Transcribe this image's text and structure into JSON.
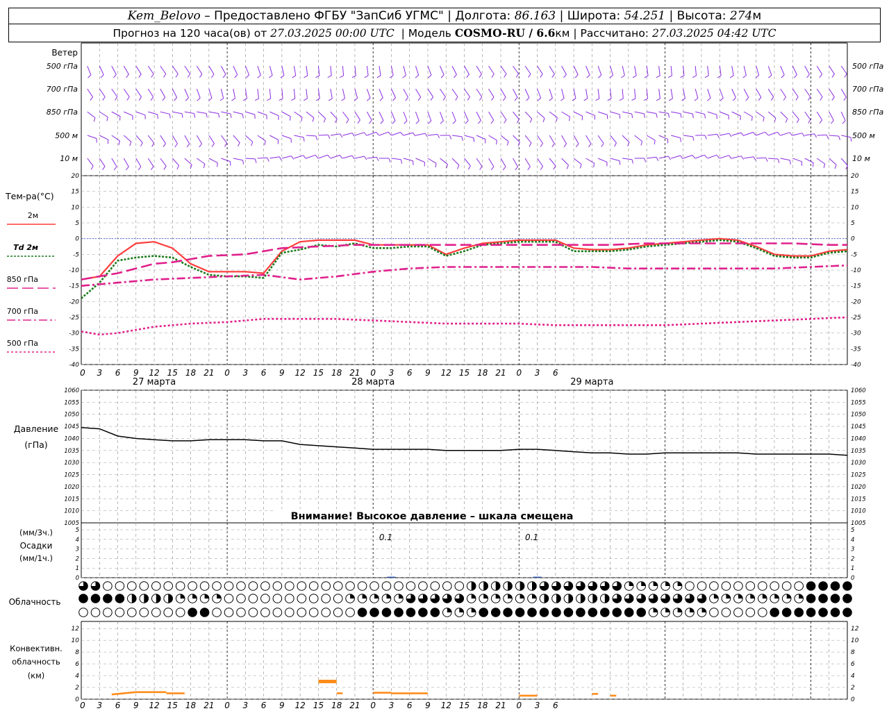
{
  "header": {
    "station": "Kem_Belovo",
    "provided": "– Предоставлено ФГБУ \"ЗапСиб УГМС\"",
    "lon_label": "Долгота:",
    "lon": "86.163",
    "lat_label": "Широта:",
    "lat": "54.251",
    "alt_label": "Высота:",
    "alt": "274",
    "alt_unit": "м",
    "forecast_label": "Прогноз на 120 часа(ов) от",
    "forecast_time": "27.03.2025 00:00 UTC",
    "model_label": "Модель",
    "model": "COSMO-RU / 6.6",
    "model_unit": "км",
    "calc_label": "Рассчитано:",
    "calc_time": "27.03.2025 04:42 UTC"
  },
  "wind_panel": {
    "title": "Ветер",
    "levels": [
      "500 гПа",
      "700 гПа",
      "850 гПа",
      "500 м",
      "10  м"
    ],
    "levels_right": [
      "500 гПа",
      "700 гПа",
      "850 гПа",
      "500 м",
      "10  м"
    ],
    "barb_color": "#8a2be2"
  },
  "axis": {
    "hour_labels": [
      "0",
      "3",
      "6",
      "9",
      "12",
      "15",
      "18",
      "21",
      "0",
      "3",
      "6",
      "9",
      "12",
      "15",
      "18",
      "21",
      "0",
      "3",
      "6",
      "9",
      "12",
      "15",
      "18",
      "21",
      "0",
      "3",
      "6"
    ],
    "dates": [
      "27 марта",
      "28 марта",
      "29 марта"
    ]
  },
  "temp_panel": {
    "title": "Тем-ра(°C)",
    "legend": [
      {
        "label": "2м",
        "color": "#ff3c3c",
        "dash": ""
      },
      {
        "label": "Td  2м",
        "color": "#1a7a1a",
        "dash": "3,2"
      },
      {
        "label": "850 гПа",
        "color": "#e0208c",
        "dash": "16,6"
      },
      {
        "label": "700 гПа",
        "color": "#e0208c",
        "dash": "12,4,3,4"
      },
      {
        "label": "500 гПа",
        "color": "#e0208c",
        "dash": "3,3"
      }
    ],
    "y_ticks": [
      "20",
      "15",
      "10",
      "5",
      "0",
      "-5",
      "-10",
      "-15",
      "-20",
      "-25",
      "-30",
      "-35",
      "-40"
    ]
  },
  "pressure_panel": {
    "title1": "Давление",
    "title2": "(гПа)",
    "y_ticks": [
      "1060",
      "1055",
      "1050",
      "1045",
      "1040",
      "1035",
      "1030",
      "1025",
      "1020",
      "1015",
      "1010",
      "1005"
    ],
    "warning": "Внимание! Высокое давление – шкала смещена"
  },
  "precip_panel": {
    "title1": "(мм/3ч.)",
    "title2": "Осадки",
    "title3": "(мм/1ч.)",
    "y_ticks": [
      "5",
      "4",
      "3",
      "2",
      "1",
      "0"
    ],
    "annotations": [
      {
        "hour": 51,
        "text": "0.1"
      },
      {
        "hour": 75,
        "text": "0.1"
      }
    ]
  },
  "cloud_panel": {
    "title": "Облачность"
  },
  "conv_panel": {
    "title1": "Конвективн.",
    "title2": "облачность",
    "title3": "(км)",
    "y_ticks": [
      "12",
      "10",
      "8",
      "6",
      "4",
      "2",
      "0"
    ],
    "color": "#ff8c1a"
  },
  "chart_data": {
    "type": "line",
    "x_unit": "hours since 27.03.2025 00:00 UTC",
    "x_range": [
      0,
      126
    ],
    "series": [
      {
        "name": "2м",
        "panel": "temperature",
        "unit": "°C",
        "points": [
          [
            0,
            -13
          ],
          [
            3,
            -12
          ],
          [
            6,
            -5.5
          ],
          [
            9,
            -1.5
          ],
          [
            12,
            -1
          ],
          [
            15,
            -3
          ],
          [
            18,
            -8
          ],
          [
            21,
            -10.5
          ],
          [
            24,
            -10.5
          ],
          [
            27,
            -10.5
          ],
          [
            30,
            -11
          ],
          [
            33,
            -4
          ],
          [
            36,
            -1
          ],
          [
            39,
            -0.5
          ],
          [
            42,
            -0.5
          ],
          [
            45,
            -0.5
          ],
          [
            48,
            -2
          ],
          [
            51,
            -2
          ],
          [
            54,
            -2
          ],
          [
            57,
            -2
          ],
          [
            60,
            -5
          ],
          [
            63,
            -3
          ],
          [
            66,
            -1.5
          ],
          [
            69,
            -1
          ],
          [
            72,
            -0.5
          ],
          [
            75,
            -0.5
          ],
          [
            78,
            -0.5
          ],
          [
            81,
            -3
          ],
          [
            84,
            -3.5
          ],
          [
            87,
            -3.5
          ],
          [
            90,
            -3
          ],
          [
            93,
            -2
          ],
          [
            96,
            -1.5
          ],
          [
            99,
            -1
          ],
          [
            102,
            -0.5
          ],
          [
            105,
            0
          ],
          [
            108,
            -0.5
          ],
          [
            111,
            -2.5
          ],
          [
            114,
            -5
          ],
          [
            117,
            -5.5
          ],
          [
            120,
            -5.5
          ],
          [
            123,
            -4
          ],
          [
            126,
            -3.5
          ]
        ]
      },
      {
        "name": "Td  2м",
        "panel": "temperature",
        "unit": "°C",
        "points": [
          [
            0,
            -19
          ],
          [
            3,
            -14
          ],
          [
            6,
            -7
          ],
          [
            9,
            -6
          ],
          [
            12,
            -5.5
          ],
          [
            15,
            -6
          ],
          [
            18,
            -9
          ],
          [
            21,
            -11.5
          ],
          [
            24,
            -12
          ],
          [
            27,
            -12
          ],
          [
            30,
            -12.5
          ],
          [
            33,
            -4.5
          ],
          [
            36,
            -3.5
          ],
          [
            39,
            -2
          ],
          [
            42,
            -2.5
          ],
          [
            45,
            -1.5
          ],
          [
            48,
            -3
          ],
          [
            51,
            -3
          ],
          [
            54,
            -2.5
          ],
          [
            57,
            -2.5
          ],
          [
            60,
            -5.5
          ],
          [
            63,
            -4
          ],
          [
            66,
            -2
          ],
          [
            69,
            -1.5
          ],
          [
            72,
            -1
          ],
          [
            75,
            -1
          ],
          [
            78,
            -1
          ],
          [
            81,
            -4
          ],
          [
            84,
            -4
          ],
          [
            87,
            -4
          ],
          [
            90,
            -3.5
          ],
          [
            93,
            -2.5
          ],
          [
            96,
            -2
          ],
          [
            99,
            -1.5
          ],
          [
            102,
            -1
          ],
          [
            105,
            -0.5
          ],
          [
            108,
            -1
          ],
          [
            111,
            -3
          ],
          [
            114,
            -5.5
          ],
          [
            117,
            -6
          ],
          [
            120,
            -6
          ],
          [
            123,
            -4.5
          ],
          [
            126,
            -4
          ]
        ]
      },
      {
        "name": "850 гПа",
        "panel": "temperature",
        "unit": "°C",
        "points": [
          [
            0,
            -13
          ],
          [
            6,
            -11
          ],
          [
            12,
            -8
          ],
          [
            15,
            -7.5
          ],
          [
            21,
            -5.5
          ],
          [
            27,
            -5
          ],
          [
            33,
            -3
          ],
          [
            39,
            -2.5
          ],
          [
            45,
            -2
          ],
          [
            51,
            -2
          ],
          [
            57,
            -2
          ],
          [
            63,
            -2
          ],
          [
            69,
            -2
          ],
          [
            75,
            -2
          ],
          [
            81,
            -2
          ],
          [
            87,
            -2
          ],
          [
            93,
            -1.5
          ],
          [
            99,
            -1.5
          ],
          [
            105,
            -1.5
          ],
          [
            111,
            -1.5
          ],
          [
            117,
            -1.5
          ],
          [
            123,
            -2
          ],
          [
            126,
            -2
          ]
        ]
      },
      {
        "name": "700 гПа",
        "panel": "temperature",
        "unit": "°C",
        "points": [
          [
            0,
            -15
          ],
          [
            6,
            -14
          ],
          [
            12,
            -13
          ],
          [
            18,
            -12.5
          ],
          [
            24,
            -12
          ],
          [
            30,
            -11.5
          ],
          [
            36,
            -13
          ],
          [
            42,
            -12
          ],
          [
            48,
            -10.5
          ],
          [
            54,
            -9.5
          ],
          [
            60,
            -9
          ],
          [
            66,
            -9
          ],
          [
            72,
            -9
          ],
          [
            78,
            -9
          ],
          [
            84,
            -9
          ],
          [
            90,
            -9.5
          ],
          [
            96,
            -9.5
          ],
          [
            102,
            -9.5
          ],
          [
            108,
            -9.5
          ],
          [
            114,
            -9.5
          ],
          [
            120,
            -9
          ],
          [
            126,
            -8.5
          ]
        ]
      },
      {
        "name": "500 гПа",
        "panel": "temperature",
        "unit": "°C",
        "points": [
          [
            0,
            -29.5
          ],
          [
            3,
            -30.5
          ],
          [
            6,
            -30
          ],
          [
            9,
            -29
          ],
          [
            12,
            -28
          ],
          [
            18,
            -27
          ],
          [
            24,
            -26.5
          ],
          [
            30,
            -25.5
          ],
          [
            36,
            -25.5
          ],
          [
            42,
            -25.5
          ],
          [
            48,
            -26
          ],
          [
            54,
            -26.5
          ],
          [
            60,
            -27
          ],
          [
            66,
            -27
          ],
          [
            72,
            -27
          ],
          [
            78,
            -27.5
          ],
          [
            84,
            -27.5
          ],
          [
            90,
            -27.5
          ],
          [
            96,
            -27.5
          ],
          [
            102,
            -27
          ],
          [
            108,
            -26.5
          ],
          [
            114,
            -26
          ],
          [
            120,
            -25.5
          ],
          [
            126,
            -25
          ]
        ]
      },
      {
        "name": "Давление",
        "panel": "pressure",
        "unit": "гПа",
        "points": [
          [
            0,
            1044.5
          ],
          [
            3,
            1044
          ],
          [
            6,
            1041
          ],
          [
            9,
            1040
          ],
          [
            12,
            1039.5
          ],
          [
            15,
            1039
          ],
          [
            18,
            1039
          ],
          [
            21,
            1039.5
          ],
          [
            24,
            1039.5
          ],
          [
            27,
            1039.5
          ],
          [
            30,
            1039
          ],
          [
            33,
            1039
          ],
          [
            36,
            1037.5
          ],
          [
            39,
            1037
          ],
          [
            42,
            1036.5
          ],
          [
            45,
            1036
          ],
          [
            48,
            1035.5
          ],
          [
            51,
            1035.5
          ],
          [
            54,
            1035.5
          ],
          [
            57,
            1035.5
          ],
          [
            60,
            1035
          ],
          [
            63,
            1035
          ],
          [
            66,
            1035
          ],
          [
            69,
            1035
          ],
          [
            72,
            1035.5
          ],
          [
            75,
            1035.5
          ],
          [
            78,
            1035
          ],
          [
            81,
            1034.5
          ],
          [
            84,
            1034
          ],
          [
            87,
            1034
          ],
          [
            90,
            1033.5
          ],
          [
            93,
            1033.5
          ],
          [
            96,
            1034
          ],
          [
            99,
            1034
          ],
          [
            102,
            1034
          ],
          [
            105,
            1034
          ],
          [
            108,
            1034
          ],
          [
            111,
            1033.5
          ],
          [
            114,
            1033.5
          ],
          [
            117,
            1033.5
          ],
          [
            120,
            1033.5
          ],
          [
            123,
            1033.5
          ],
          [
            126,
            1033
          ]
        ]
      },
      {
        "name": "Осадки",
        "panel": "precipitation",
        "unit": "мм/3ч.",
        "points": [
          [
            51,
            0.1
          ],
          [
            75,
            0.1
          ]
        ]
      },
      {
        "name": "Конвективн. облачность",
        "panel": "convective",
        "unit": "км",
        "segments": [
          [
            5,
            9,
            0.8,
            1.2
          ],
          [
            9,
            14,
            1.2,
            1.2
          ],
          [
            14,
            17,
            1.0,
            1.0
          ],
          [
            39,
            42,
            3.0,
            3.0
          ],
          [
            42,
            43,
            1.0,
            1.0
          ],
          [
            48,
            51,
            1.1,
            1.1
          ],
          [
            51,
            57,
            1.0,
            1.0
          ],
          [
            72,
            75,
            0.6,
            0.6
          ],
          [
            84,
            85,
            0.9,
            0.9
          ],
          [
            87,
            88,
            0.6,
            0.6
          ]
        ]
      }
    ],
    "cloud_cover": {
      "rows": [
        "upper",
        "middle",
        "low"
      ],
      "note": "Each row: fraction 0..1 per 1-hour step"
    }
  }
}
